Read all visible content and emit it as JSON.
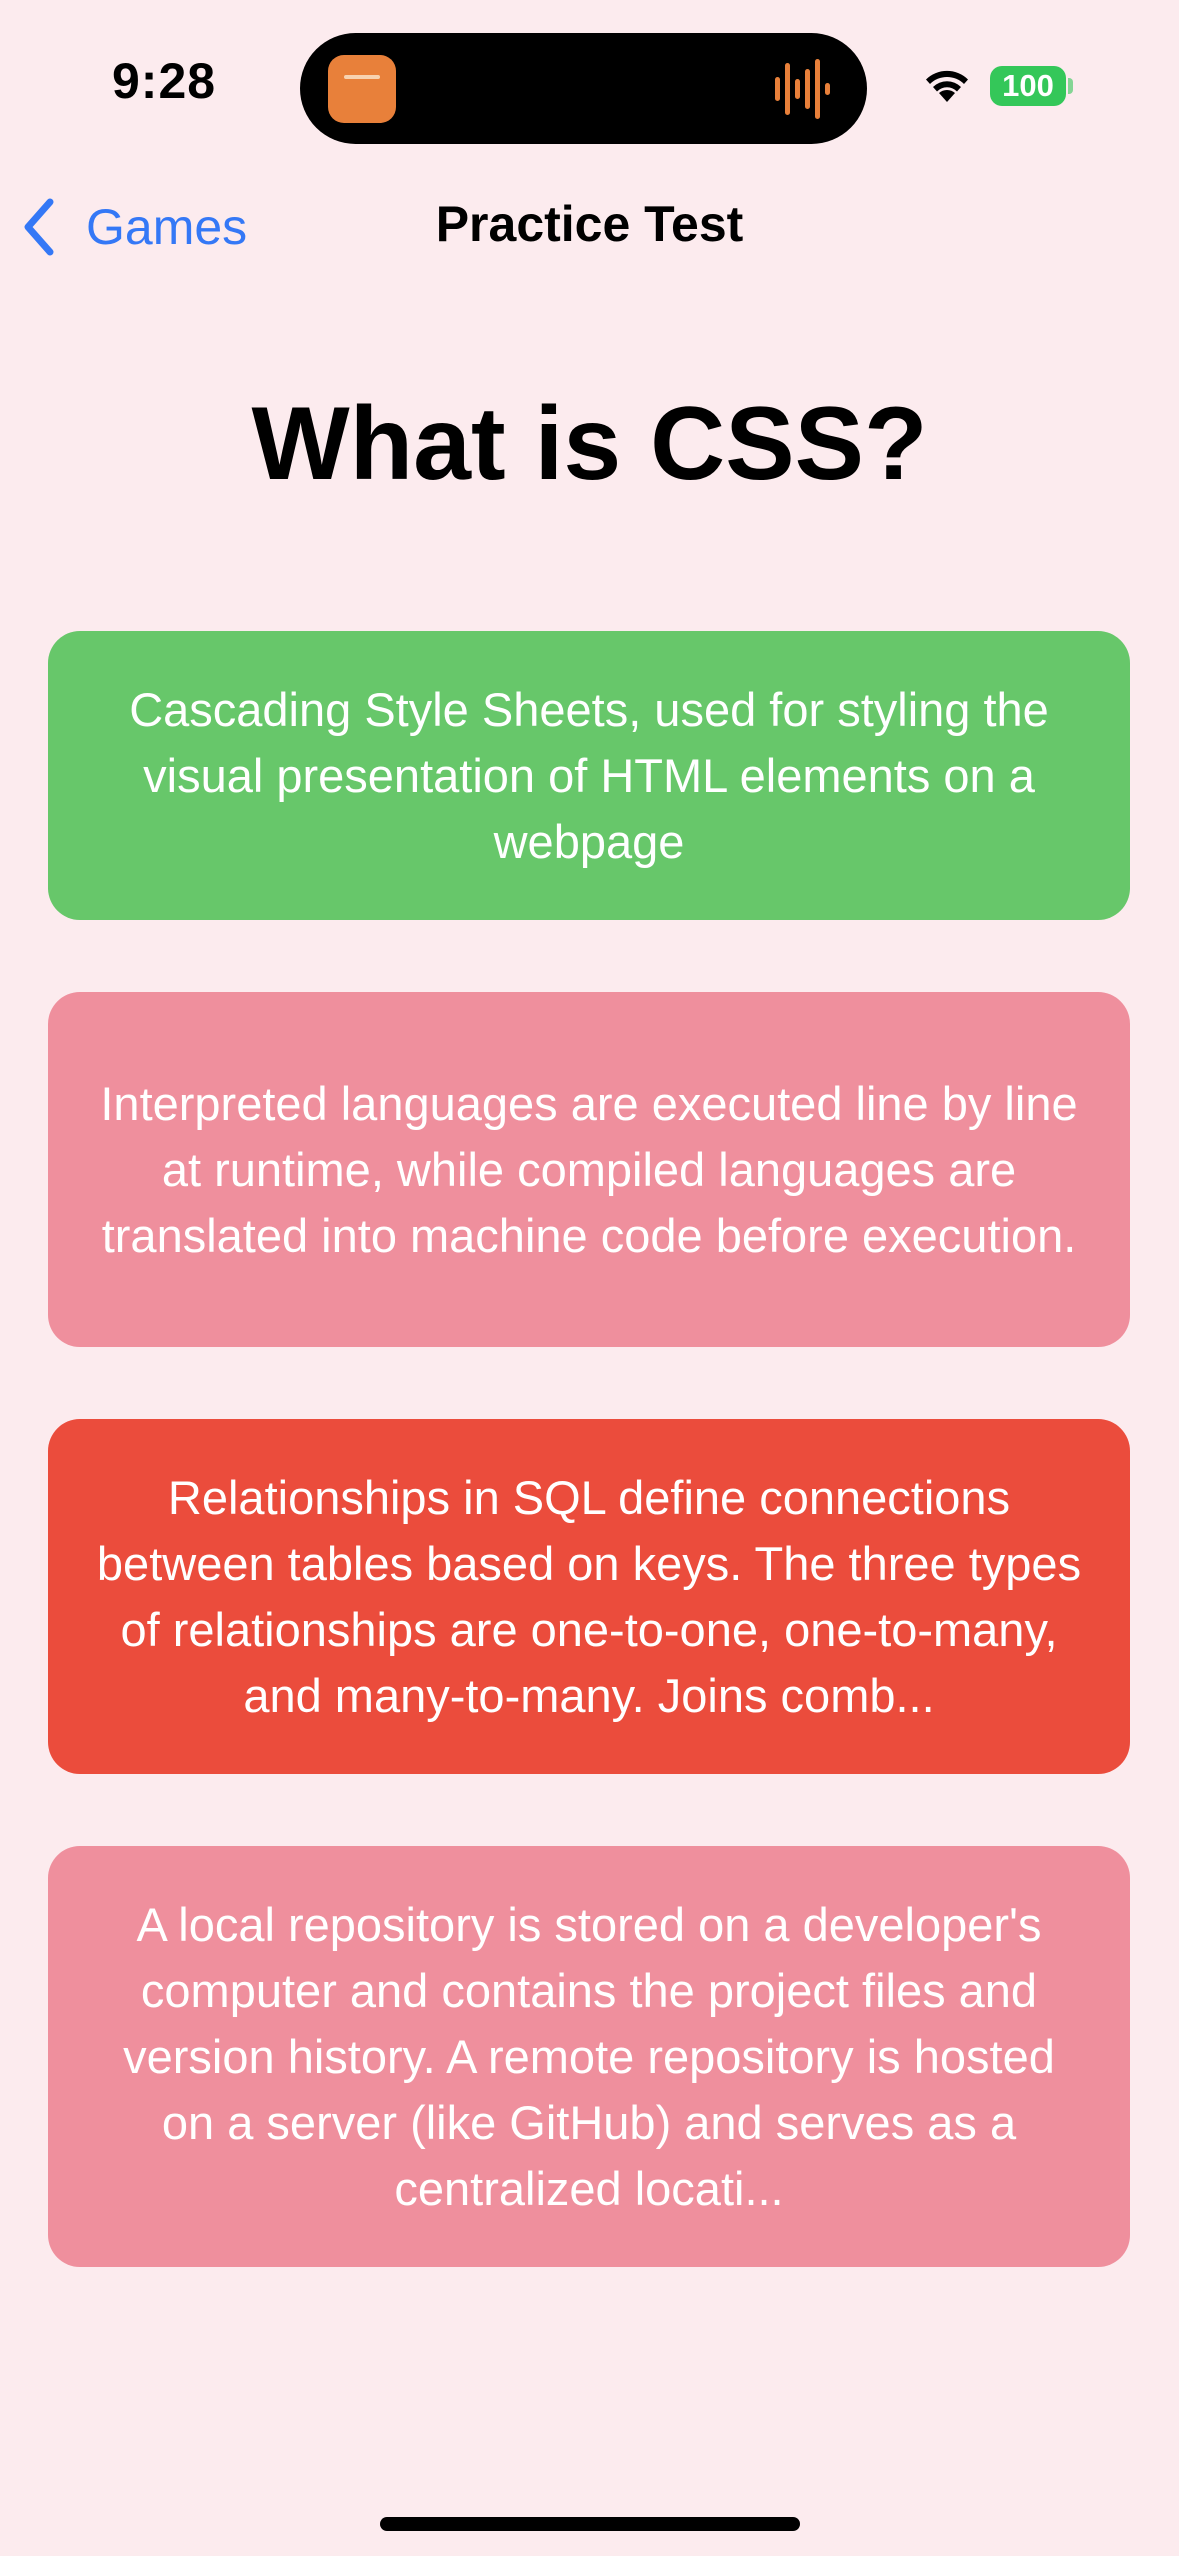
{
  "status_bar": {
    "time": "9:28",
    "battery": "100",
    "battery_color": "#34c759",
    "wifi_icon": "wifi-icon",
    "island_app_color": "#e8803a",
    "island_wave_color": "#e8803a"
  },
  "nav": {
    "back_label": "Games",
    "back_icon": "chevron-left-icon",
    "title": "Practice Test",
    "accent": "#3478f6"
  },
  "question": "What is CSS?",
  "answers": [
    {
      "text": "Cascading Style Sheets, used for styling the visual presentation of HTML elements on a webpage",
      "color": "#67c76a",
      "state": "correct"
    },
    {
      "text": "Interpreted languages are executed line by line at runtime, while compiled languages are translated into machine code before execution.",
      "color": "#ef8f9d",
      "state": "unselected"
    },
    {
      "text": "Relationships in SQL define connections between tables based on keys. The three types of relationships are one-to-one, one-to-many, and many-to-many. Joins comb...",
      "color": "#eb4c3c",
      "state": "selected-wrong"
    },
    {
      "text": "A local repository is stored on a developer's computer and contains the project files and version history. A remote repository is hosted on a server (like GitHub) and serves as a centralized locati...",
      "color": "#ef8f9d",
      "state": "unselected"
    }
  ],
  "background": "#fcebee"
}
